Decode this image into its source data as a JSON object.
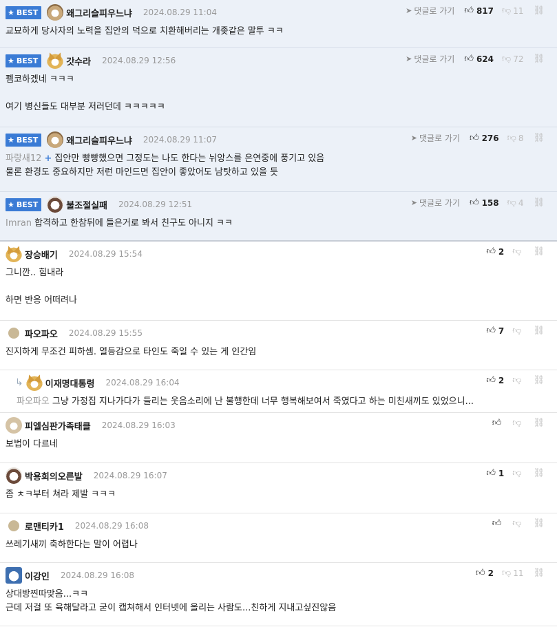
{
  "best_comments": [
    {
      "badge": "BEST",
      "avatar": "dog",
      "nickname": "왜그리슬피우느냐",
      "date": "2024.08.29 11:04",
      "goto": "댓글로 가기",
      "likes": "817",
      "dislikes": "11",
      "lines": [
        "교묘하게 당사자의 노력을 집안의 덕으로 치환해버리는 개좆같은 말투 ㅋㅋ"
      ]
    },
    {
      "badge": "BEST",
      "avatar": "fox",
      "nickname": "갓수라",
      "date": "2024.08.29 12:56",
      "goto": "댓글로 가기",
      "likes": "624",
      "dislikes": "72",
      "lines": [
        "펨코하겠네 ㅋㅋㅋ",
        "",
        "여기 병신들도 대부분 저러던데 ㅋㅋㅋㅋㅋ"
      ]
    },
    {
      "badge": "BEST",
      "avatar": "dog",
      "nickname": "왜그리슬피우느냐",
      "date": "2024.08.29 11:07",
      "goto": "댓글로 가기",
      "likes": "276",
      "dislikes": "8",
      "mention": "파랑새12",
      "plus": "+",
      "lines": [
        "집안만 빵빵했으면 그정도는 나도 한다는 뉘앙스를 은연중에 풍기고 있음",
        "물론 환경도 중요하지만 저런 마인드면 집안이 좋았어도 남탓하고 있을 듯"
      ]
    },
    {
      "badge": "BEST",
      "avatar": "panda",
      "nickname": "불조절실패",
      "date": "2024.08.29 12:51",
      "goto": "댓글로 가기",
      "likes": "158",
      "dislikes": "4",
      "mention": "Imran",
      "lines": [
        "합격하고 한참뒤에 들은거로 봐서 친구도 아니지 ㅋㅋ"
      ]
    }
  ],
  "comments": [
    {
      "avatar": "fox",
      "nickname": "장승배기",
      "date": "2024.08.29 15:54",
      "likes": "2",
      "lines": [
        "그니깐.. 힘내라",
        "",
        "하면 반응 어떠려나"
      ]
    },
    {
      "avatar": "dot",
      "nickname": "파오파오",
      "date": "2024.08.29 15:55",
      "likes": "7",
      "lines": [
        "진지하게 무조건 피하셈. 열등감으로 타인도 죽일 수 있는 게 인간임"
      ]
    },
    {
      "reply": true,
      "avatar": "fox",
      "nickname": "이재명대통령",
      "date": "2024.08.29 16:04",
      "likes": "2",
      "mention": "파오파오",
      "lines": [
        "그냥 가정집 지나가다가 들리는 웃음소리에 난 불행한데 너무 행복해보여서 죽였다고 하는 미친새끼도 있었으니..."
      ]
    },
    {
      "avatar": "pup",
      "nickname": "피엘심판가족태클",
      "date": "2024.08.29 16:03",
      "likes": "",
      "lines": [
        "보법이 다르네"
      ]
    },
    {
      "avatar": "panda",
      "nickname": "박용희의오른발",
      "date": "2024.08.29 16:07",
      "likes": "1",
      "lines": [
        "좀 ㅊㅋ부터 쳐라 제발 ㅋㅋㅋ"
      ]
    },
    {
      "avatar": "dot",
      "nickname": "로맨티카1",
      "date": "2024.08.29 16:08",
      "likes": "",
      "lines": [
        "쓰레기새끼 축하한다는 말이 어렵나"
      ]
    },
    {
      "avatar": "blue",
      "nickname": "이강인",
      "date": "2024.08.29 16:08",
      "likes": "2",
      "dislikes": "11",
      "lines": [
        "상대방찐따맞음...ㅋㅋ",
        "근데 저걸 또 육해달라고 굳이 캡쳐해서 인터넷에 올리는 사람도...친하게 지내고싶진않음"
      ]
    }
  ],
  "icons": {
    "like": "thumbs-up-icon",
    "dislike": "thumbs-down-icon",
    "link": "link-icon",
    "goto": "send-arrow-icon",
    "star": "star-icon",
    "reply": "reply-arrow-icon"
  },
  "colors": {
    "best_bg": "#ecf1f8",
    "badge": "#3a7bd5",
    "date": "#999999"
  }
}
